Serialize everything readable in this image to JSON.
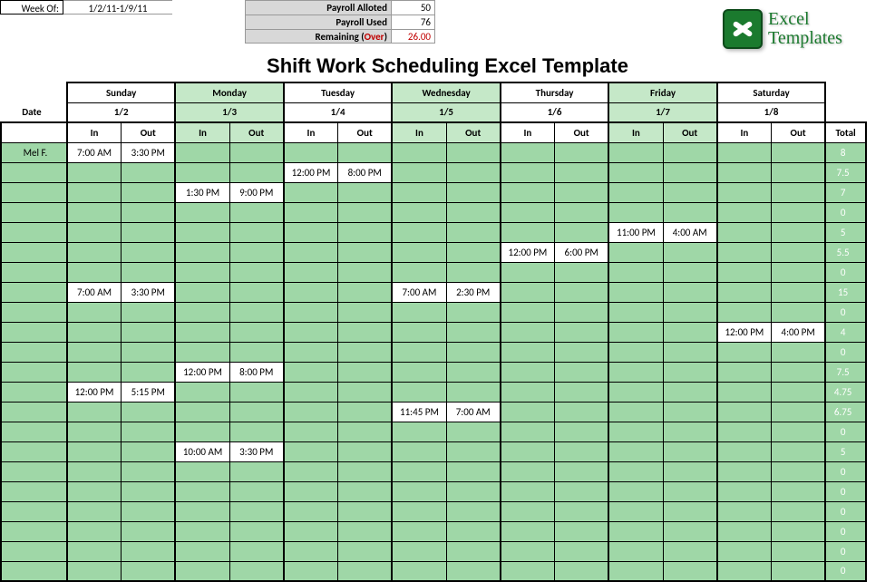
{
  "header": {
    "week_label": "Week Of:",
    "week_value": "1/2/11-1/9/11",
    "payroll": [
      {
        "label": "Payroll Alloted",
        "value": "50",
        "red": false
      },
      {
        "label": "Payroll Used",
        "value": "76",
        "red": false
      },
      {
        "label": "Remaining (Over)",
        "value": "26.00",
        "red": true,
        "label_red_part": "Over"
      }
    ]
  },
  "logo": {
    "line1": "Excel",
    "line2": "Templates"
  },
  "title": "Shift Work Scheduling Excel Template",
  "days": [
    "Sunday",
    "Monday",
    "Tuesday",
    "Wednesday",
    "Thursday",
    "Friday",
    "Saturday"
  ],
  "alt_days": [
    false,
    true,
    false,
    true,
    false,
    true,
    false
  ],
  "date_label": "Date",
  "dates": [
    "1/2",
    "1/3",
    "1/4",
    "1/5",
    "1/6",
    "1/7",
    "1/8"
  ],
  "inout": {
    "in": "In",
    "out": "Out"
  },
  "total_label": "Total",
  "rows": [
    {
      "name": "Mel F.",
      "cells": [
        "7:00 AM",
        "3:30 PM",
        "",
        "",
        "",
        "",
        "",
        "",
        "",
        "",
        "",
        "",
        "",
        ""
      ],
      "total": "8"
    },
    {
      "name": "",
      "cells": [
        "",
        "",
        "",
        "",
        "12:00 PM",
        "8:00 PM",
        "",
        "",
        "",
        "",
        "",
        "",
        "",
        ""
      ],
      "total": "7.5"
    },
    {
      "name": "",
      "cells": [
        "",
        "",
        "1:30 PM",
        "9:00 PM",
        "",
        "",
        "",
        "",
        "",
        "",
        "",
        "",
        "",
        ""
      ],
      "total": "7"
    },
    {
      "name": "",
      "cells": [
        "",
        "",
        "",
        "",
        "",
        "",
        "",
        "",
        "",
        "",
        "",
        "",
        "",
        ""
      ],
      "total": "0"
    },
    {
      "name": "",
      "cells": [
        "",
        "",
        "",
        "",
        "",
        "",
        "",
        "",
        "",
        "",
        "11:00 PM",
        "4:00 AM",
        "",
        ""
      ],
      "total": "5"
    },
    {
      "name": "",
      "cells": [
        "",
        "",
        "",
        "",
        "",
        "",
        "",
        "",
        "12:00 PM",
        "6:00 PM",
        "",
        "",
        "",
        ""
      ],
      "total": "5.5"
    },
    {
      "name": "",
      "cells": [
        "",
        "",
        "",
        "",
        "",
        "",
        "",
        "",
        "",
        "",
        "",
        "",
        "",
        ""
      ],
      "total": "0"
    },
    {
      "name": "",
      "cells": [
        "7:00 AM",
        "3:30 PM",
        "",
        "",
        "",
        "",
        "7:00 AM",
        "2:30 PM",
        "",
        "",
        "",
        "",
        "",
        ""
      ],
      "total": "15"
    },
    {
      "name": "",
      "cells": [
        "",
        "",
        "",
        "",
        "",
        "",
        "",
        "",
        "",
        "",
        "",
        "",
        "",
        ""
      ],
      "total": "0"
    },
    {
      "name": "",
      "cells": [
        "",
        "",
        "",
        "",
        "",
        "",
        "",
        "",
        "",
        "",
        "",
        "",
        "12:00 PM",
        "4:00 PM"
      ],
      "total": "4"
    },
    {
      "name": "",
      "cells": [
        "",
        "",
        "",
        "",
        "",
        "",
        "",
        "",
        "",
        "",
        "",
        "",
        "",
        ""
      ],
      "total": "0"
    },
    {
      "name": "",
      "cells": [
        "",
        "",
        "12:00 PM",
        "8:00 PM",
        "",
        "",
        "",
        "",
        "",
        "",
        "",
        "",
        "",
        ""
      ],
      "total": "7.5"
    },
    {
      "name": "",
      "cells": [
        "12:00 PM",
        "5:15 PM",
        "",
        "",
        "",
        "",
        "",
        "",
        "",
        "",
        "",
        "",
        "",
        ""
      ],
      "total": "4.75"
    },
    {
      "name": "",
      "cells": [
        "",
        "",
        "",
        "",
        "",
        "",
        "11:45 PM",
        "7:00 AM",
        "",
        "",
        "",
        "",
        "",
        ""
      ],
      "total": "6.75"
    },
    {
      "name": "",
      "cells": [
        "",
        "",
        "",
        "",
        "",
        "",
        "",
        "",
        "",
        "",
        "",
        "",
        "",
        ""
      ],
      "total": "0"
    },
    {
      "name": "",
      "cells": [
        "",
        "",
        "10:00 AM",
        "3:30 PM",
        "",
        "",
        "",
        "",
        "",
        "",
        "",
        "",
        "",
        ""
      ],
      "total": "5"
    },
    {
      "name": "",
      "cells": [
        "",
        "",
        "",
        "",
        "",
        "",
        "",
        "",
        "",
        "",
        "",
        "",
        "",
        ""
      ],
      "total": "0"
    },
    {
      "name": "",
      "cells": [
        "",
        "",
        "",
        "",
        "",
        "",
        "",
        "",
        "",
        "",
        "",
        "",
        "",
        ""
      ],
      "total": "0"
    },
    {
      "name": "",
      "cells": [
        "",
        "",
        "",
        "",
        "",
        "",
        "",
        "",
        "",
        "",
        "",
        "",
        "",
        ""
      ],
      "total": "0"
    },
    {
      "name": "",
      "cells": [
        "",
        "",
        "",
        "",
        "",
        "",
        "",
        "",
        "",
        "",
        "",
        "",
        "",
        ""
      ],
      "total": "0"
    },
    {
      "name": "",
      "cells": [
        "",
        "",
        "",
        "",
        "",
        "",
        "",
        "",
        "",
        "",
        "",
        "",
        "",
        ""
      ],
      "total": "0"
    },
    {
      "name": "",
      "cells": [
        "",
        "",
        "",
        "",
        "",
        "",
        "",
        "",
        "",
        "",
        "",
        "",
        "",
        ""
      ],
      "total": "0"
    }
  ]
}
